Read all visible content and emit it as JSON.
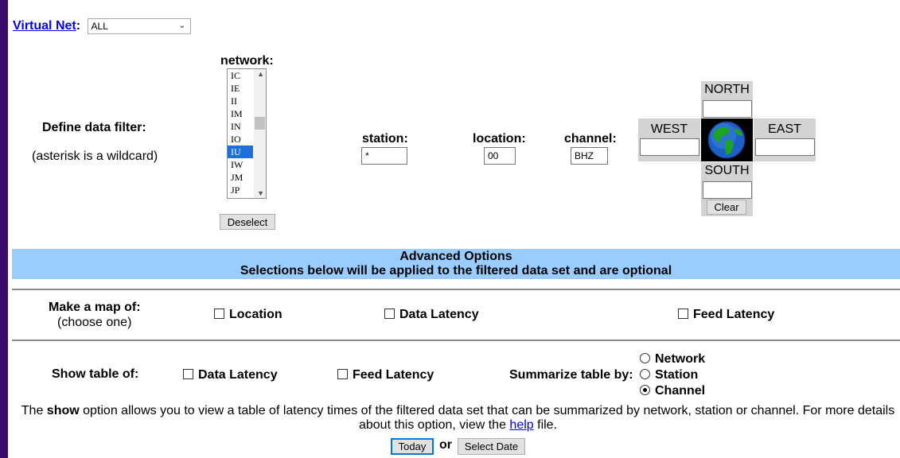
{
  "virtual_net": {
    "link_label": "Virtual Net",
    "colon": ":",
    "selected": "ALL"
  },
  "filter": {
    "define_label": "Define data filter:",
    "wildcard_note": "(asterisk is a wildcard)",
    "network_label": "network:",
    "network_options": [
      "IC",
      "IE",
      "II",
      "IM",
      "IN",
      "IO",
      "IU",
      "IW",
      "JM",
      "JP"
    ],
    "network_selected": "IU",
    "deselect_label": "Deselect",
    "station_label": "station:",
    "station_value": "*",
    "location_label": "location:",
    "location_value": "00",
    "channel_label": "channel:",
    "channel_value": "BHZ"
  },
  "compass": {
    "north": "NORTH",
    "west": "WEST",
    "east": "EAST",
    "south": "SOUTH",
    "clear_label": "Clear"
  },
  "advanced": {
    "title": "Advanced Options",
    "subtitle": "Selections below will be applied to the filtered data set and are optional"
  },
  "map": {
    "label": "Make a map of:",
    "sub": "(choose one)",
    "opt_location": "Location",
    "opt_data_latency": "Data Latency",
    "opt_feed_latency": "Feed Latency"
  },
  "table": {
    "label": "Show table of:",
    "opt_data_latency": "Data Latency",
    "opt_feed_latency": "Feed Latency",
    "summarize_label": "Summarize table by:",
    "radio_network": "Network",
    "radio_station": "Station",
    "radio_channel": "Channel",
    "selected": "Channel"
  },
  "help": {
    "pre": "The ",
    "bold": "show",
    "mid": " option allows you to view a table of latency times of the filtered data set that can be summarized by network, station or channel. For more details about this option, view the ",
    "link": "help",
    "post": " file."
  },
  "actions": {
    "today_label": "Today",
    "or_label": "or",
    "select_date_label": "Select Date"
  }
}
